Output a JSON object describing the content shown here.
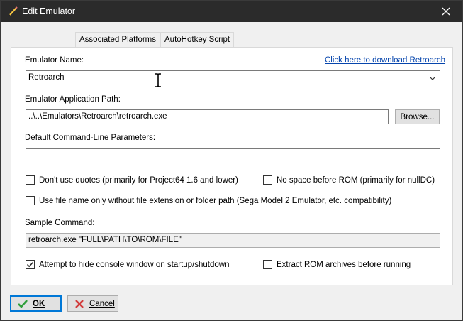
{
  "window": {
    "title": "Edit Emulator",
    "close_glyph": "✕"
  },
  "tabs": [
    {
      "label": "Associated Platforms",
      "active": false
    },
    {
      "label": "AutoHotkey Script",
      "active": false
    }
  ],
  "form": {
    "emulator_name_label": "Emulator Name:",
    "download_link": "Click here to download Retroarch",
    "emulator_name_value": "Retroarch",
    "app_path_label": "Emulator Application Path:",
    "app_path_value": "..\\..\\Emulators\\Retroarch\\retroarch.exe",
    "browse_label": "Browse...",
    "cmdline_label": "Default Command-Line Parameters:",
    "cmdline_value": "",
    "checkbox_no_quotes": {
      "label": "Don't use quotes (primarily for Project64 1.6 and lower)",
      "checked": false
    },
    "checkbox_no_space": {
      "label": "No space before ROM (primarily for nullDC)",
      "checked": false
    },
    "checkbox_filename_only": {
      "label": "Use file name only without file extension or folder path (Sega Model 2 Emulator, etc. compatibility)",
      "checked": false
    },
    "sample_command_label": "Sample Command:",
    "sample_command_value": "retroarch.exe \"FULL\\PATH\\TO\\ROM\\FILE\"",
    "checkbox_hide_console": {
      "label": "Attempt to hide console window on startup/shutdown",
      "checked": true
    },
    "checkbox_extract_rom": {
      "label": "Extract ROM archives before running",
      "checked": false
    }
  },
  "footer": {
    "ok_label": "OK",
    "cancel_label": "Cancel"
  },
  "colors": {
    "titlebar": "#2b2b2b",
    "link": "#0645ad",
    "focus": "#0078d7"
  }
}
